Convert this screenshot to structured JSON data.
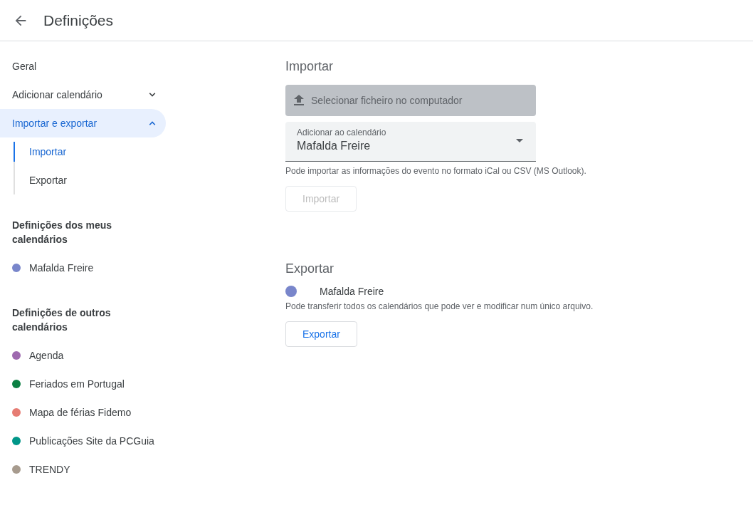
{
  "header": {
    "title": "Definições"
  },
  "sidebar": {
    "items": [
      {
        "label": "Geral",
        "kind": "plain",
        "selected": false
      },
      {
        "label": "Adicionar calendário",
        "kind": "expandable",
        "expanded": false,
        "selected": false
      },
      {
        "label": "Importar e exportar",
        "kind": "expandable",
        "expanded": true,
        "selected": true,
        "children": [
          {
            "label": "Importar",
            "selected": true
          },
          {
            "label": "Exportar",
            "selected": false
          }
        ]
      }
    ],
    "sections": [
      {
        "title": "Definições dos meus calendários",
        "calendars": [
          {
            "name": "Mafalda Freire",
            "color": "#7986cb"
          }
        ]
      },
      {
        "title": "Definições de outros calendários",
        "calendars": [
          {
            "name": "Agenda",
            "color": "#9e69af"
          },
          {
            "name": "Feriados em Portugal",
            "color": "#0b8043"
          },
          {
            "name": "Mapa de férias Fidemo",
            "color": "#e67c73"
          },
          {
            "name": "Publicações Site da PCGuia",
            "color": "#009688"
          },
          {
            "name": "TRENDY",
            "color": "#a79b8e"
          }
        ]
      }
    ]
  },
  "import": {
    "title": "Importar",
    "file_button": "Selecionar ficheiro no computador",
    "calendar_select": {
      "label": "Adicionar ao calendário",
      "value": "Mafalda Freire"
    },
    "hint": "Pode importar as informações do evento no formato iCal ou CSV (MS Outlook).",
    "button": {
      "label": "Importar",
      "disabled": true
    }
  },
  "export": {
    "title": "Exportar",
    "calendar": {
      "name": "Mafalda Freire",
      "color": "#7986cb"
    },
    "hint": "Pode transferir todos os calendários que pode ver e modificar num único arquivo.",
    "button": {
      "label": "Exportar",
      "disabled": false
    }
  }
}
